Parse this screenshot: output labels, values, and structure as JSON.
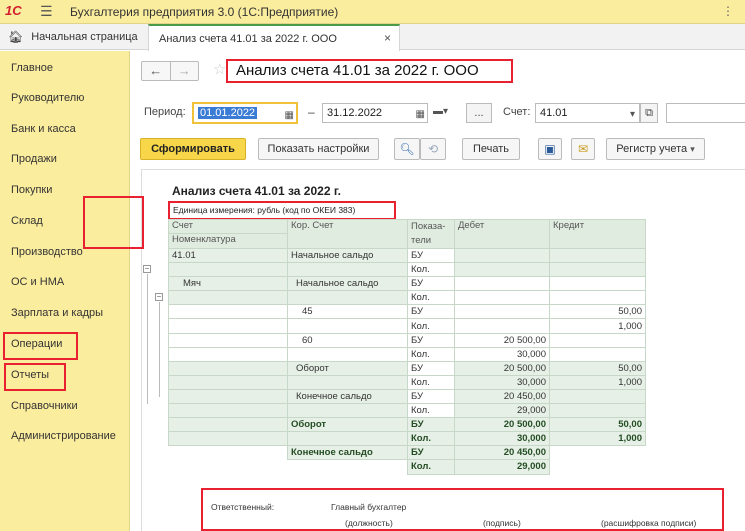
{
  "app": {
    "logo": "1С",
    "title": "Бухгалтерия предприятия 3.0  (1С:Предприятие)",
    "menu_dots": "⋮"
  },
  "tabs": {
    "home": "Начальная страница",
    "active": "Анализ счета 41.01 за 2022 г. ООО"
  },
  "sidebar": {
    "items": [
      "Главное",
      "Руководителю",
      "Банк и касса",
      "Продажи",
      "Покупки",
      "Склад",
      "Производство",
      "ОС и НМА",
      "Зарплата и кадры",
      "Операции",
      "Отчеты",
      "Справочники",
      "Администрирование"
    ]
  },
  "page": {
    "title": "Анализ счета 41.01 за 2022 г. ООО"
  },
  "filters": {
    "period_label": "Период:",
    "date_from": "01.01.2022",
    "date_to": "31.12.2022",
    "dash": "–",
    "ellipsis": "...",
    "account_label": "Счет:",
    "account_value": "41.01"
  },
  "actions": {
    "generate": "Сформировать",
    "show_settings": "Показать настройки",
    "print": "Печать",
    "register": "Регистр учета"
  },
  "report": {
    "title": "Анализ счета 41.01 за 2022 г.",
    "unit": "Единица измерения: рубль (код по ОКЕИ 383)",
    "headers": {
      "account": "Счет",
      "nomenclature": "Номенклатура",
      "corr_account": "Кор. Счет",
      "indicator": "Показа-\nтели",
      "debit": "Дебет",
      "credit": "Кредит"
    },
    "rows": [
      {
        "acct": "41.01",
        "corr": "Начальное сальдо",
        "ind": "БУ",
        "debit": "",
        "credit": ""
      },
      {
        "acct": "",
        "corr": "",
        "ind": "Кол.",
        "debit": "",
        "credit": ""
      },
      {
        "acct": "Мяч",
        "corr": "Начальное сальдо",
        "ind": "БУ",
        "debit": "",
        "credit": ""
      },
      {
        "acct": "",
        "corr": "",
        "ind": "Кол.",
        "debit": "",
        "credit": ""
      },
      {
        "acct": "",
        "corr": "45",
        "ind": "БУ",
        "debit": "",
        "credit": "50,00"
      },
      {
        "acct": "",
        "corr": "",
        "ind": "Кол.",
        "debit": "",
        "credit": "1,000"
      },
      {
        "acct": "",
        "corr": "60",
        "ind": "БУ",
        "debit": "20 500,00",
        "credit": ""
      },
      {
        "acct": "",
        "corr": "",
        "ind": "Кол.",
        "debit": "30,000",
        "credit": ""
      },
      {
        "acct": "",
        "corr": "Оборот",
        "ind": "БУ",
        "debit": "20 500,00",
        "credit": "50,00"
      },
      {
        "acct": "",
        "corr": "",
        "ind": "Кол.",
        "debit": "30,000",
        "credit": "1,000"
      },
      {
        "acct": "",
        "corr": "Конечное сальдо",
        "ind": "БУ",
        "debit": "20 450,00",
        "credit": ""
      },
      {
        "acct": "",
        "corr": "",
        "ind": "Кол.",
        "debit": "29,000",
        "credit": ""
      },
      {
        "acct": "",
        "corr": "Оборот",
        "ind": "БУ",
        "debit": "20 500,00",
        "credit": "50,00"
      },
      {
        "acct": "",
        "corr": "",
        "ind": "Кол.",
        "debit": "30,000",
        "credit": "1,000"
      },
      {
        "acct": "",
        "corr": "Конечное сальдо",
        "ind": "БУ",
        "debit": "20 450,00",
        "credit": ""
      },
      {
        "acct": "",
        "corr": "",
        "ind": "Кол.",
        "debit": "29,000",
        "credit": ""
      }
    ]
  },
  "signature": {
    "responsible": "Ответственный:",
    "position_value": "Главный бухгалтер",
    "position_caption": "(должность)",
    "sign_caption": "(подпись)",
    "decode_caption": "(расшифровка подписи)"
  }
}
